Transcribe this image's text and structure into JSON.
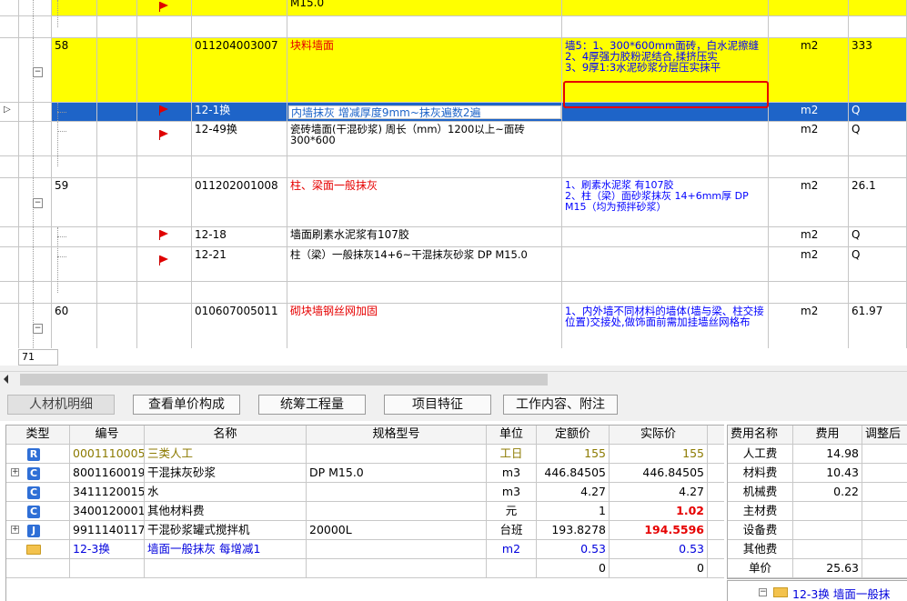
{
  "top_grid": {
    "row0": {
      "col9": "M15.0"
    },
    "row58": {
      "index": "58",
      "code": "011204003007",
      "name": "块料墙面",
      "feature": "墙5：1、300*600mm面砖，白水泥擦缝\n2、4厚强力胶粉泥结合,揉挤压实\n3、9厚1:3水泥砂浆分层压实抹平",
      "unit": "m2",
      "qty": "333"
    },
    "row_sel": {
      "code": "12-1换",
      "name": "内墙抹灰 增减厚度9mm~抹灰遍数2遍",
      "unit": "m2",
      "qty": "Q"
    },
    "row_1249": {
      "code": "12-49换",
      "name": "瓷砖墙面(干混砂浆) 周长（mm）1200以上~面砖300*600",
      "unit": "m2",
      "qty": "Q"
    },
    "row59": {
      "index": "59",
      "code": "011202001008",
      "name": "柱、梁面一般抹灰",
      "feature": "1、刷素水泥浆 有107胶\n2、柱（梁）面砂浆抹灰 14+6mm厚 DP M15（均为预拌砂浆）",
      "unit": "m2",
      "qty": "26.1"
    },
    "row_1218": {
      "code": "12-18",
      "name": "墙面刷素水泥浆有107胶",
      "unit": "m2",
      "qty": "Q"
    },
    "row_1221": {
      "code": "12-21",
      "name": "柱（梁）一般抹灰14+6~干混抹灰砂浆 DP M15.0",
      "unit": "m2",
      "qty": "Q"
    },
    "row60": {
      "index": "60",
      "code": "010607005011",
      "name": "砌块墙钢丝网加固",
      "feature": "1、内外墙不同材料的墙体(墙与梁、柱交接位置)交接处,做饰面前需加挂墙丝网格布",
      "unit": "m2",
      "qty": "61.97"
    },
    "row_index_box": "71"
  },
  "tabs": [
    {
      "label": "人材机明细"
    },
    {
      "label": "查看单价构成"
    },
    {
      "label": "统筹工程量"
    },
    {
      "label": "项目特征"
    },
    {
      "label": "工作内容、附注"
    }
  ],
  "material_table": {
    "headers": [
      "类型",
      "编号",
      "名称",
      "规格型号",
      "单位",
      "定额价",
      "实际价"
    ],
    "rows": [
      {
        "type": "R",
        "code": "0001110005",
        "name": "三类人工",
        "spec": "",
        "unit": "工日",
        "quota": "155",
        "actual": "155"
      },
      {
        "type": "C",
        "code": "8001160019",
        "name": "干混抹灰砂浆",
        "spec": "DP M15.0",
        "unit": "m3",
        "quota": "446.84505",
        "actual": "446.84505"
      },
      {
        "type": "C",
        "code": "3411120015",
        "name": "水",
        "spec": "",
        "unit": "m3",
        "quota": "4.27",
        "actual": "4.27"
      },
      {
        "type": "C",
        "code": "3400120001",
        "name": "其他材料费",
        "spec": "",
        "unit": "元",
        "quota": "1",
        "actual": "1.02"
      },
      {
        "type": "J",
        "code": "9911140117",
        "name": "干混砂浆罐式搅拌机",
        "spec": "20000L",
        "unit": "台班",
        "quota": "193.8278",
        "actual": "194.5596"
      },
      {
        "type": "",
        "code": "12-3换",
        "name": "墙面一般抹灰 每增减1",
        "spec": "",
        "unit": "m2",
        "quota": "0.53",
        "actual": "0.53"
      },
      {
        "type": "",
        "code": "",
        "name": "",
        "spec": "",
        "unit": "",
        "quota": "0",
        "actual": "0"
      }
    ]
  },
  "fee_panel": {
    "headers": [
      "费用名称",
      "费用",
      "调整后"
    ],
    "rows": [
      {
        "name": "人工费",
        "value": "14.98"
      },
      {
        "name": "材料费",
        "value": "10.43"
      },
      {
        "name": "机械费",
        "value": "0.22"
      },
      {
        "name": "主材费",
        "value": ""
      },
      {
        "name": "设备费",
        "value": ""
      },
      {
        "name": "其他费",
        "value": ""
      },
      {
        "name": "单价",
        "value": "25.63"
      }
    ],
    "tree_item": "12-3换 墙面一般抹"
  },
  "colors": {
    "yellow_row": "#ffff00",
    "selection": "#1e64c8",
    "red_text": "#e60000",
    "blue_text": "#0000ff"
  }
}
